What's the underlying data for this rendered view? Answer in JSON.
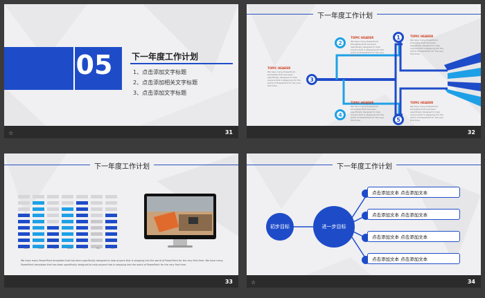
{
  "slide31": {
    "number": "05",
    "title": "下一年度工作计划",
    "items": [
      "1、点击添加文字标题",
      "2、点击添加相关文字标题",
      "3、点击添加文字标题"
    ],
    "page_num": "31"
  },
  "slide32": {
    "title": "下一年度工作计划",
    "page_num": "32",
    "topic_header": "TOPIC HEADER",
    "topic_body": "We have many PowerPoint templates that has been specifically designed to help anyone that is stepping into the world of PowerPoint for the very first time.",
    "nodes": [
      "1",
      "2",
      "3",
      "4",
      "5"
    ]
  },
  "slide33": {
    "title": "下一年度工作计划",
    "page_num": "33",
    "days": [
      "SUN",
      "MON",
      "TUE",
      "WED",
      "THU",
      "FRI",
      "SAT"
    ],
    "caption": "We have many PowerPoint templates that has been specifically designed to help anyone that is stepping into the world of PowerPoint for the very first time. We have many PowerPoint templates that has been specifically designed to help anyone that is stepping into the world of PowerPoint for the very first time."
  },
  "slide34": {
    "title": "下一年度工作计划",
    "page_num": "34",
    "left_circle": "初步目标",
    "center_circle": "进一步目标",
    "boxes": [
      "点击添加文本 点击添加文本",
      "点击添加文本 点击添加文本",
      "点击添加文本 点击添加文本",
      "点击添加文本 点击添加文本"
    ]
  },
  "colors": {
    "primary": "#1e4cc9",
    "accent": "#1ea0e6",
    "footer": "#2b2b2b",
    "background": "#f0f0f2"
  }
}
